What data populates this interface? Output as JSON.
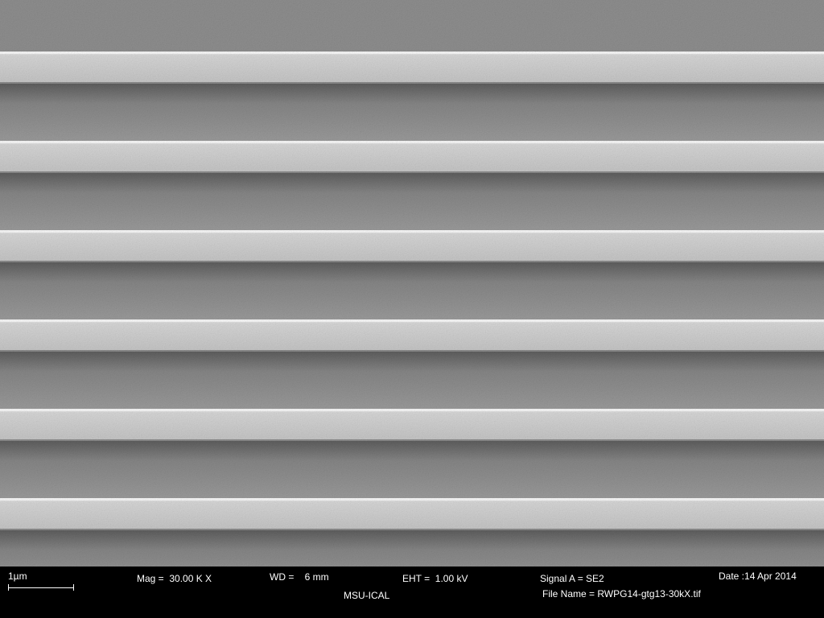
{
  "databar": {
    "scale_label": "1µm",
    "mag": "Mag =  30.00 K X",
    "wd": "WD =    6 mm",
    "eht": "EHT =  1.00 kV",
    "signal": "Signal A = SE2",
    "date": "Date :14 Apr 2014",
    "lab": "MSU-ICAL",
    "file_name": "File Name = RWPG14-gtg13-30kX.tif"
  },
  "micrograph": {
    "grating_lines": 6,
    "colors": {
      "trench": "#8f8f8f",
      "ridge": "#d2d2d2",
      "edge_highlight": "#f5f5f5",
      "shadow": "#5e5e5e"
    }
  }
}
